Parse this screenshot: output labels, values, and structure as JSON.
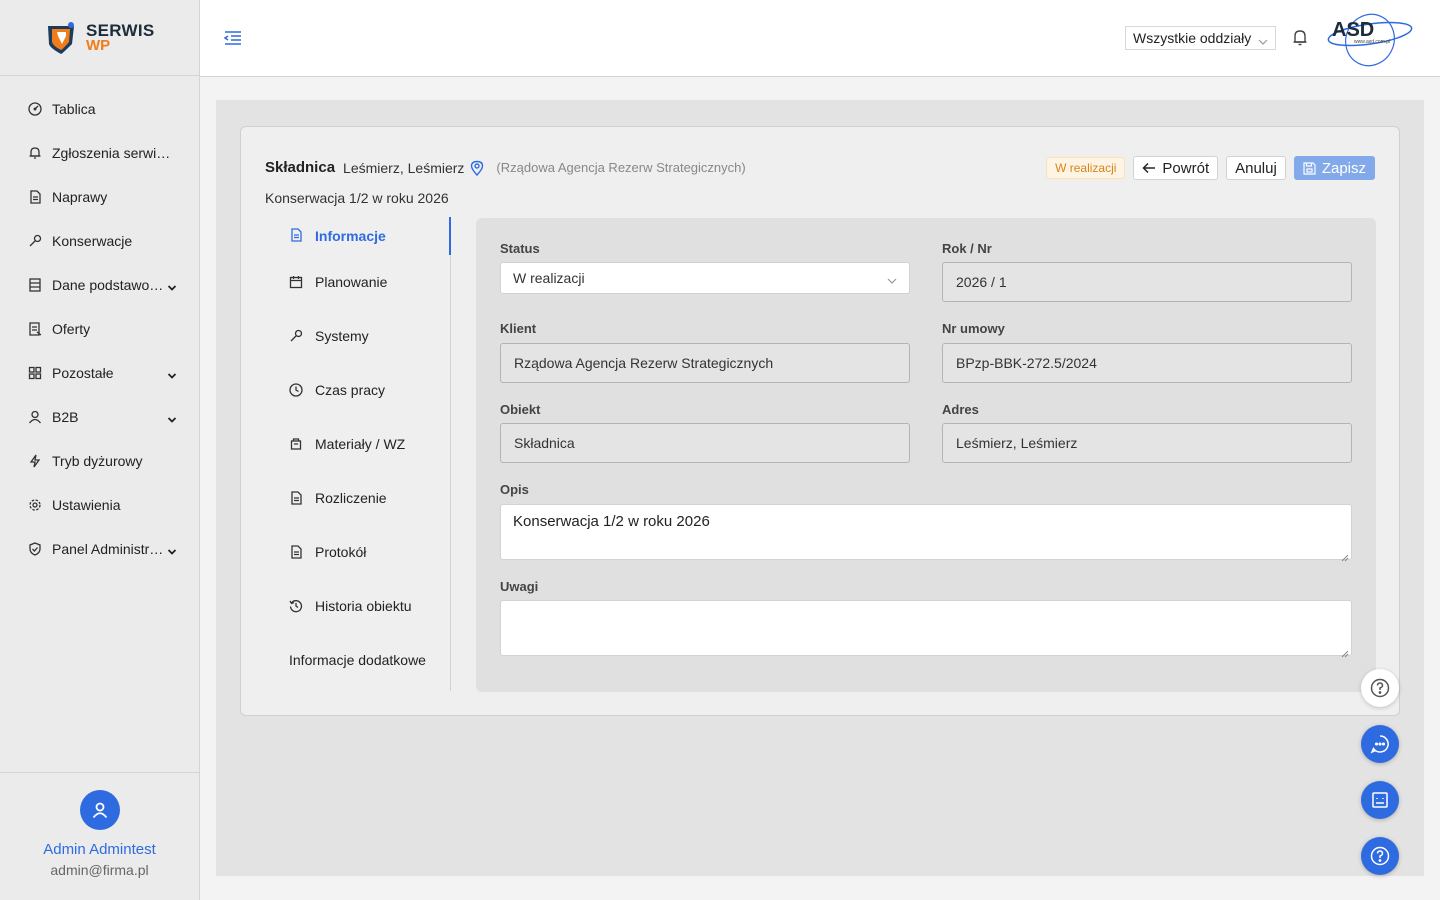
{
  "app": {
    "logo_line1": "SERWIS",
    "logo_line2": "WP",
    "branch_select": "Wszystkie oddziały",
    "partner_logo": "ASD",
    "partner_url": "www.asd.com.pl"
  },
  "sidebar": {
    "items": [
      {
        "label": "Tablica",
        "icon": "dashboard-icon"
      },
      {
        "label": "Zgłoszenia serwisowe",
        "icon": "bell-icon"
      },
      {
        "label": "Naprawy",
        "icon": "document-icon"
      },
      {
        "label": "Konserwacje",
        "icon": "wrench-icon"
      },
      {
        "label": "Dane podstawowe",
        "icon": "database-icon",
        "expandable": true
      },
      {
        "label": "Oferty",
        "icon": "offer-icon"
      },
      {
        "label": "Pozostałe",
        "icon": "grid-icon",
        "expandable": true
      },
      {
        "label": "B2B",
        "icon": "user-icon",
        "expandable": true
      },
      {
        "label": "Tryb dyżurowy",
        "icon": "lightning-icon"
      },
      {
        "label": "Ustawienia",
        "icon": "gear-icon"
      },
      {
        "label": "Panel Administratora",
        "icon": "shield-icon",
        "expandable": true
      }
    ],
    "user": {
      "name": "Admin Admintest",
      "email": "admin@firma.pl"
    }
  },
  "record": {
    "object_name": "Składnica",
    "object_address": "Leśmierz, Leśmierz",
    "client_label": "(Rządowa Agencja Rezerw Strategicznych)",
    "subtitle": "Konserwacja 1/2 w roku 2026",
    "status_badge": "W realizacji",
    "actions": {
      "back": "Powrót",
      "cancel": "Anuluj",
      "save": "Zapisz"
    }
  },
  "tabs": [
    {
      "label": "Informacje",
      "icon": "document-icon",
      "active": true
    },
    {
      "label": "Planowanie",
      "icon": "calendar-icon"
    },
    {
      "label": "Systemy",
      "icon": "wrench-icon"
    },
    {
      "label": "Czas pracy",
      "icon": "clock-icon"
    },
    {
      "label": "Materiały / WZ",
      "icon": "box-icon"
    },
    {
      "label": "Rozliczenie",
      "icon": "document-icon"
    },
    {
      "label": "Protokół",
      "icon": "document-icon"
    },
    {
      "label": "Historia obiektu",
      "icon": "history-icon"
    },
    {
      "label": "Informacje dodatkowe",
      "icon": ""
    }
  ],
  "form": {
    "status": {
      "label": "Status",
      "value": "W realizacji"
    },
    "rok_nr": {
      "label": "Rok / Nr",
      "value": "2026 / 1"
    },
    "klient": {
      "label": "Klient",
      "value": "Rządowa Agencja Rezerw Strategicznych"
    },
    "nr_umowy": {
      "label": "Nr umowy",
      "value": "BPzp-BBK-272.5/2024"
    },
    "obiekt": {
      "label": "Obiekt",
      "value": "Składnica"
    },
    "adres": {
      "label": "Adres",
      "value": "Leśmierz, Leśmierz"
    },
    "opis": {
      "label": "Opis",
      "value": "Konserwacja 1/2 w roku 2026"
    },
    "uwagi": {
      "label": "Uwagi",
      "value": ""
    }
  },
  "colors": {
    "accent": "#2f6be0",
    "brand_orange": "#f07d1a",
    "badge_text": "#d8831d"
  }
}
